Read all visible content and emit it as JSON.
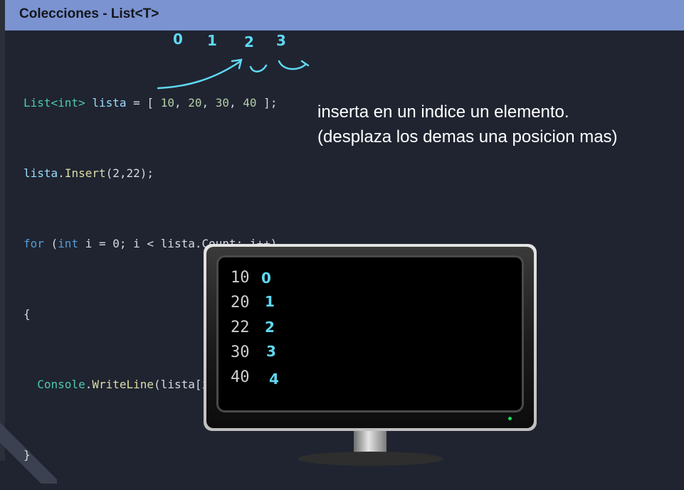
{
  "header": {
    "title": "Colecciones - List<T>"
  },
  "code": {
    "line1": {
      "type": "List",
      "generic": "<int>",
      "var": "lista",
      "eq": " = [ ",
      "v1": "10",
      "v2": "20",
      "v3": "30",
      "v4": "40",
      "end": " ];"
    },
    "line2": {
      "obj": "lista",
      "dot": ".",
      "method": "Insert",
      "args": "(2,22);"
    },
    "line3": {
      "kw_for": "for",
      "open": " (",
      "kw_int": "int",
      "rest": " i = 0; i < lista.Count; i++)"
    },
    "line4": {
      "text": "{"
    },
    "line5": {
      "cls": "Console",
      "dot": ".",
      "method": "WriteLine",
      "args": "(lista[i]);"
    },
    "line6": {
      "text": "}"
    }
  },
  "annotation": {
    "line1": "inserta en un indice un elemento.",
    "line2": "(desplaza los demas una posicion mas)"
  },
  "handwritten": {
    "indices_over_list": [
      "0",
      "1",
      "2",
      "3"
    ],
    "indices_over_output": [
      "0",
      "1",
      "2",
      "3",
      "4"
    ],
    "color": "#5fd8f2"
  },
  "console": {
    "lines": [
      "10",
      "20",
      "22",
      "30",
      "40"
    ]
  },
  "colors": {
    "title_bar": "#7b93d0",
    "background": "#1f2430",
    "type": "#4ec9b0",
    "keyword": "#569cd6"
  }
}
